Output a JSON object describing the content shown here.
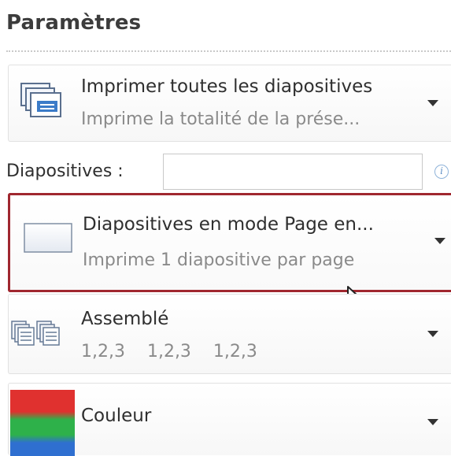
{
  "settings": {
    "title": "Paramètres",
    "print_range": {
      "main": "Imprimer toutes les diapositives",
      "sub": "Imprime la totalité de la prése...",
      "icon": "slides-stack-icon"
    },
    "slides_field": {
      "label": "Diapositives :",
      "value": "",
      "placeholder": "",
      "info_icon": "info-icon"
    },
    "layout": {
      "main": "Diapositives en mode Page en...",
      "sub": "Imprime 1 diapositive par page",
      "icon": "full-page-slide-icon"
    },
    "collation": {
      "main": "Assemblé",
      "sub": "1,2,3    1,2,3    1,2,3",
      "icon": "collated-pages-icon"
    },
    "color": {
      "main": "Couleur",
      "icon": "color-swatch-icon"
    }
  },
  "colors": {
    "selected_border": "#a0272f",
    "swatch_red": "#e0312f",
    "swatch_green": "#2eb14a",
    "swatch_blue": "#2f6fd0"
  }
}
